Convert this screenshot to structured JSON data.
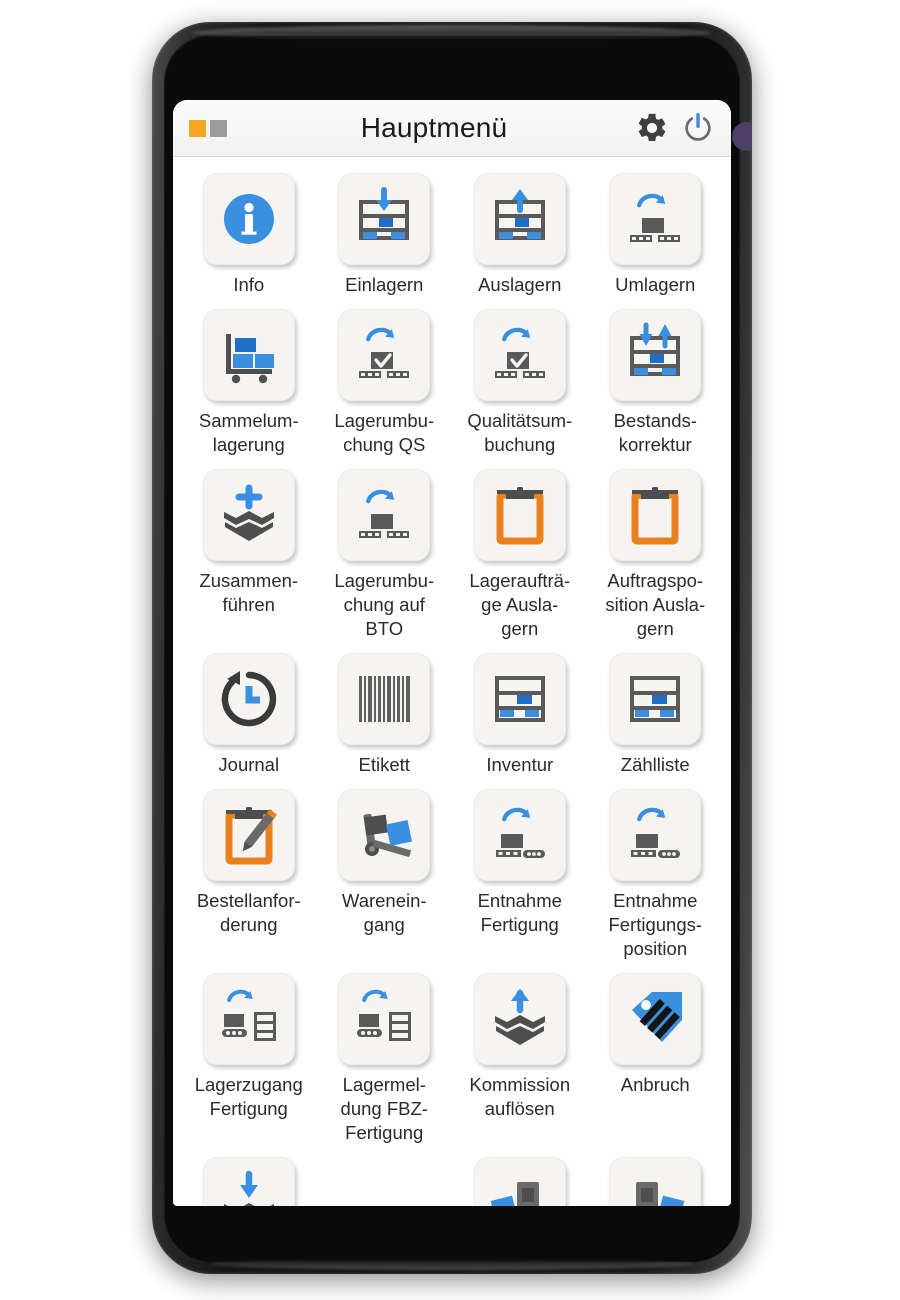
{
  "app": {
    "title": "Hauptmenü",
    "logo": {
      "square_1_color": "#f5a623",
      "square_2_color": "#9b9b9b"
    },
    "actions": [
      {
        "name": "settings",
        "icon": "gear-icon"
      },
      {
        "name": "power",
        "icon": "power-icon"
      }
    ]
  },
  "colors": {
    "accent_blue": "#3b8fe0",
    "accent_blue_dark": "#1f6fc4",
    "accent_orange": "#e8821e",
    "icon_grey": "#5a5a5a",
    "tile_bg": "#f6f4f0",
    "title_text": "#1b1b1b"
  },
  "menu": {
    "rows": [
      {
        "partial": false,
        "items": [
          {
            "label": "Info",
            "icon": "info-circle-icon"
          },
          {
            "label": "Einlagern",
            "icon": "rack-arrow-down-icon"
          },
          {
            "label": "Auslagern",
            "icon": "rack-arrow-up-icon"
          },
          {
            "label": "Umlagern",
            "icon": "pallet-curved-arrow-icon"
          }
        ]
      },
      {
        "partial": false,
        "items": [
          {
            "label": "Sammelum-\nlagerung",
            "icon": "cart-boxes-icon"
          },
          {
            "label": "Lagerumbu-\nchung QS",
            "icon": "pallet-check-arrow-icon"
          },
          {
            "label": "Qualitätsum-\nbuchung",
            "icon": "pallet-check-arrow-icon"
          },
          {
            "label": "Bestands-\nkorrektur",
            "icon": "rack-arrows-updown-icon"
          }
        ]
      },
      {
        "partial": false,
        "items": [
          {
            "label": "Zusammen-\nführen",
            "icon": "box-plus-icon"
          },
          {
            "label": "Lagerumbu-\nchung auf\nBTO",
            "icon": "pallet-curved-arrow-icon"
          },
          {
            "label": "Lageraufträ-\nge Ausla-\ngern",
            "icon": "clipboard-icon"
          },
          {
            "label": "Auftragspo-\nsition Ausla-\ngern",
            "icon": "clipboard-icon"
          }
        ]
      },
      {
        "partial": false,
        "items": [
          {
            "label": "Journal",
            "icon": "history-clock-icon"
          },
          {
            "label": "Etikett",
            "icon": "barcode-icon"
          },
          {
            "label": "Inventur",
            "icon": "rack-plain-icon"
          },
          {
            "label": "Zählliste",
            "icon": "rack-plain-icon"
          }
        ]
      },
      {
        "partial": false,
        "items": [
          {
            "label": "Bestellanfor-\nderung",
            "icon": "clipboard-pencil-icon"
          },
          {
            "label": "Warenein-\ngang",
            "icon": "hand-truck-icon"
          },
          {
            "label": "Entnahme\nFertigung",
            "icon": "pallet-conveyor-arrow-icon"
          },
          {
            "label": "Entnahme\nFertigungs-\nposition",
            "icon": "pallet-conveyor-arrow-icon"
          }
        ]
      },
      {
        "partial": false,
        "items": [
          {
            "label": "Lagerzugang\nFertigung",
            "icon": "conveyor-rack-arrow-icon"
          },
          {
            "label": "Lagermel-\ndung FBZ-\nFertigung",
            "icon": "conveyor-rack-arrow-icon"
          },
          {
            "label": "Kommission\nauflösen",
            "icon": "box-arrow-up-icon"
          },
          {
            "label": "Anbruch",
            "icon": "tag-icon"
          }
        ]
      },
      {
        "partial": true,
        "items": [
          {
            "label": "",
            "icon": "box-arrow-down-icon"
          },
          {
            "label": "",
            "icon": ""
          },
          {
            "label": "",
            "icon": "device-box-left-icon"
          },
          {
            "label": "",
            "icon": "device-box-right-icon"
          }
        ]
      }
    ]
  }
}
